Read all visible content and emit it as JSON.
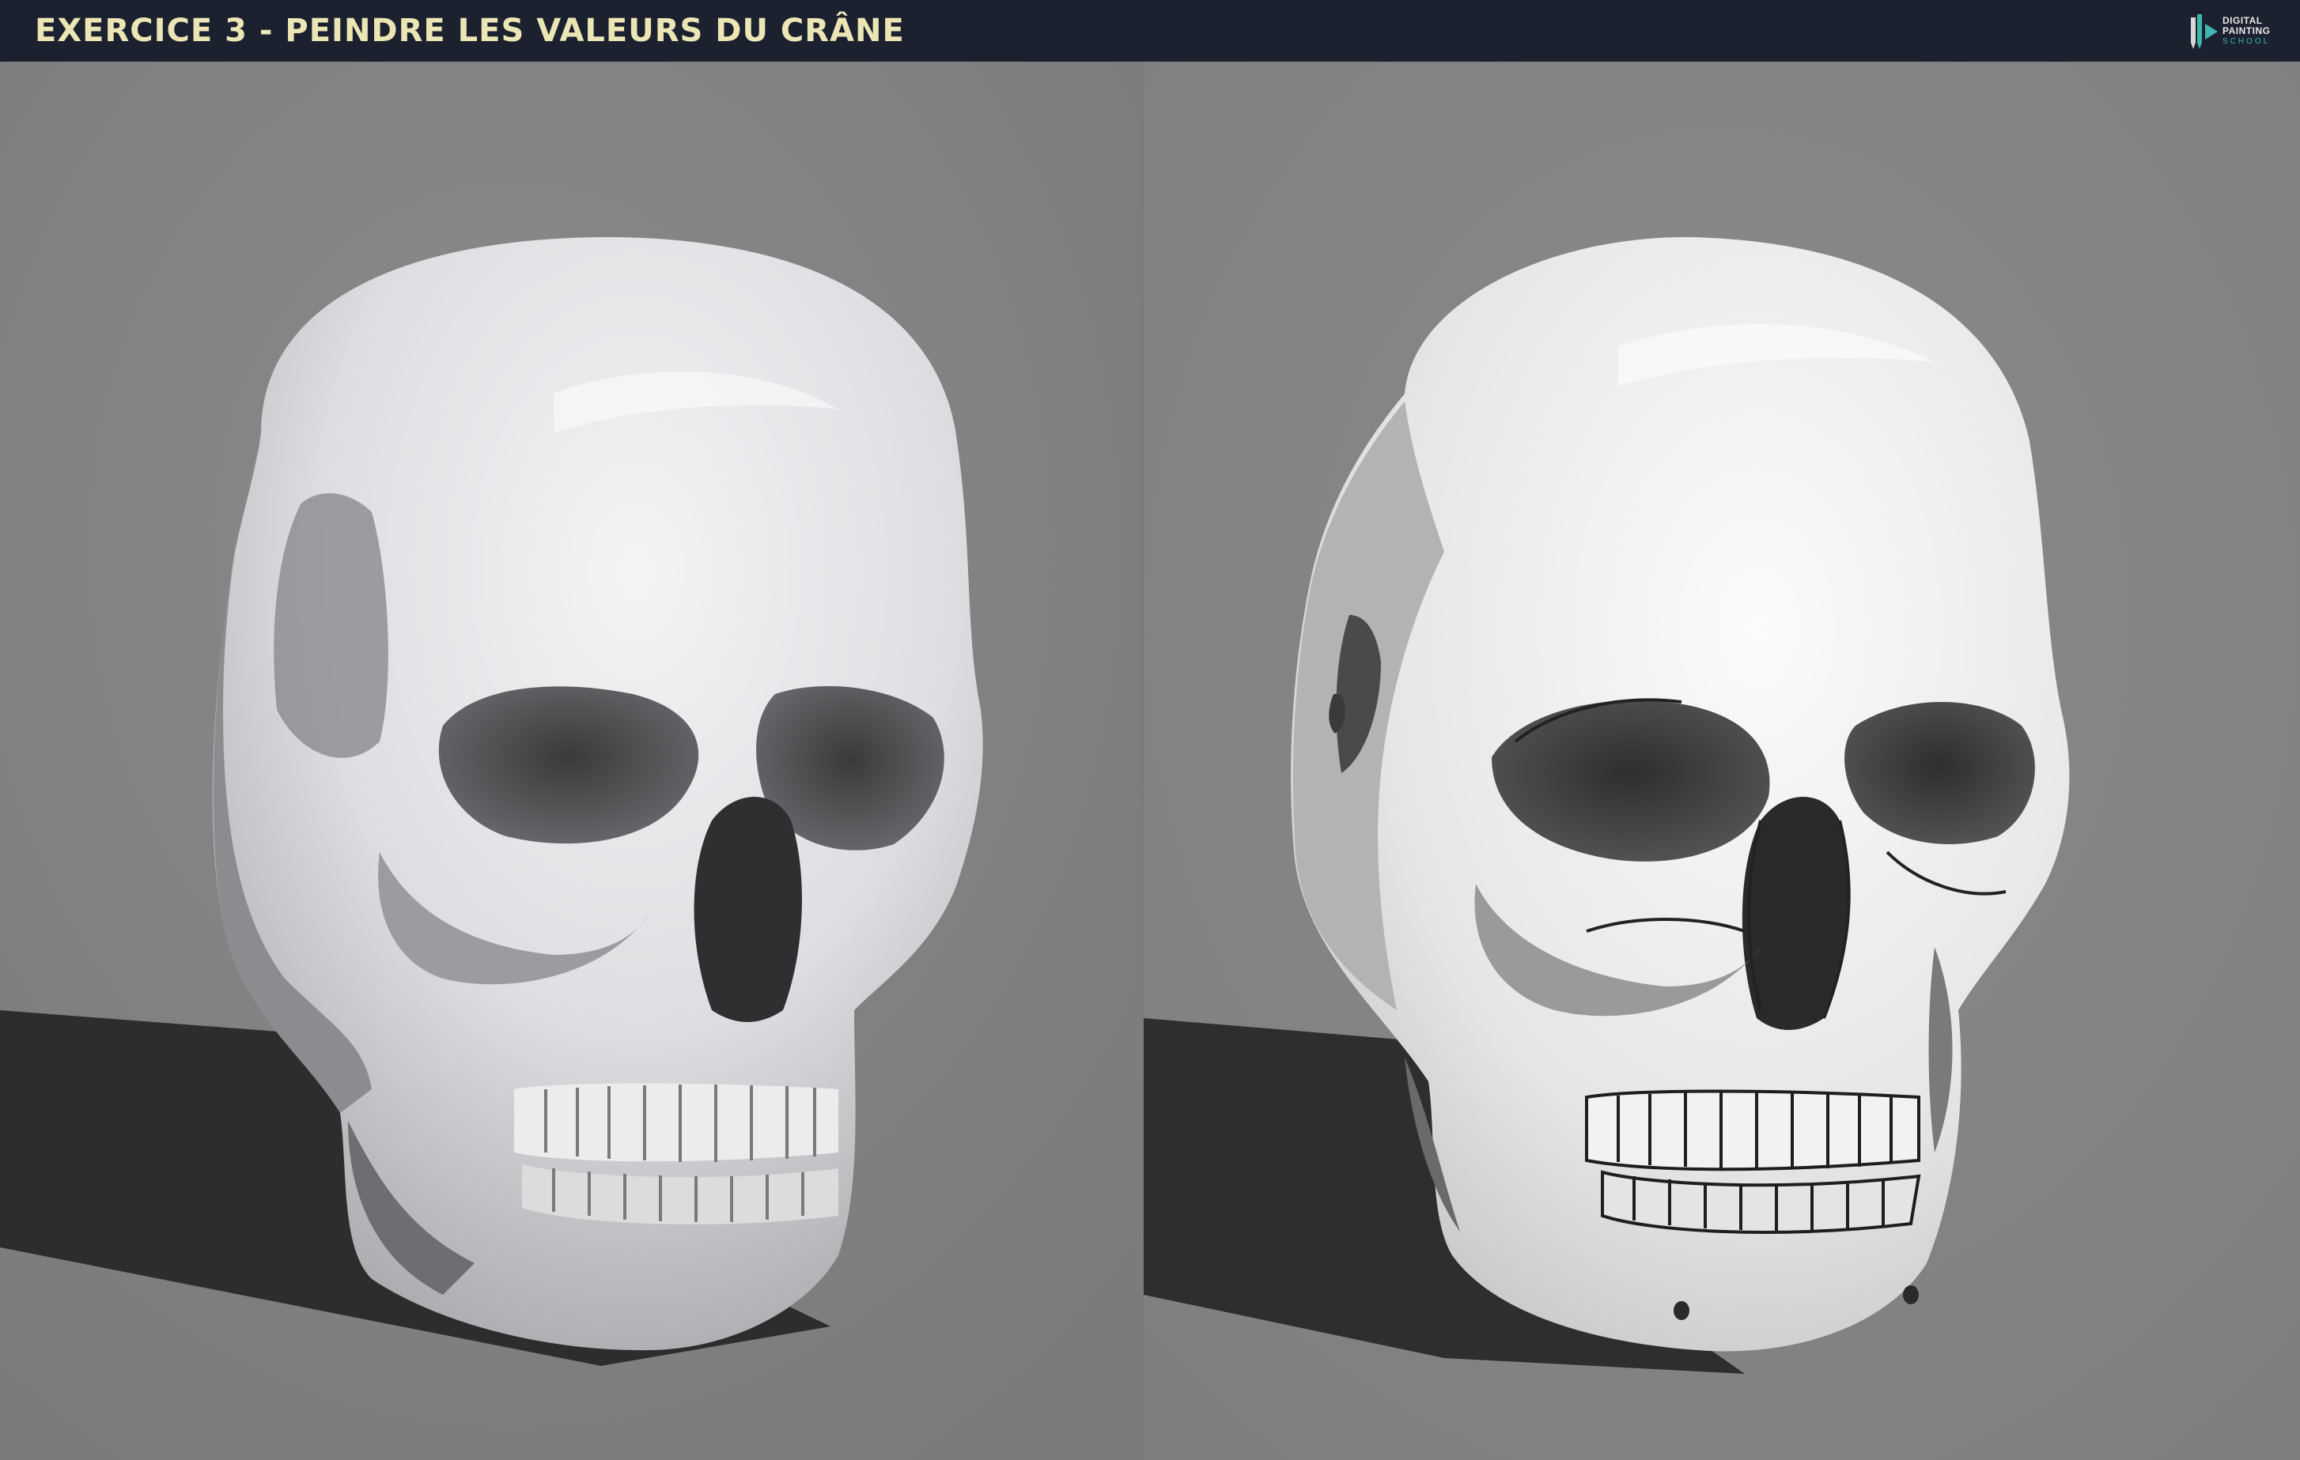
{
  "header": {
    "title": "EXERCICE 3 - PEINDRE LES VALEURS DU CRÂNE",
    "logo": {
      "line1": "DIGITAL",
      "line2": "PAINTING",
      "line3": "SCHOOL",
      "icon": "pencil-play-logo-icon"
    }
  },
  "panels": [
    {
      "name": "reference-3d-skull",
      "description_type": "photo-render"
    },
    {
      "name": "painted-skull-values",
      "description_type": "digital-painting"
    }
  ],
  "colors": {
    "header_bg": "#1c2130",
    "title_text": "#ece6b4",
    "logo_accent": "#3fb7ad",
    "background_gray": "#828282",
    "shadow": "#2e2e2e"
  }
}
